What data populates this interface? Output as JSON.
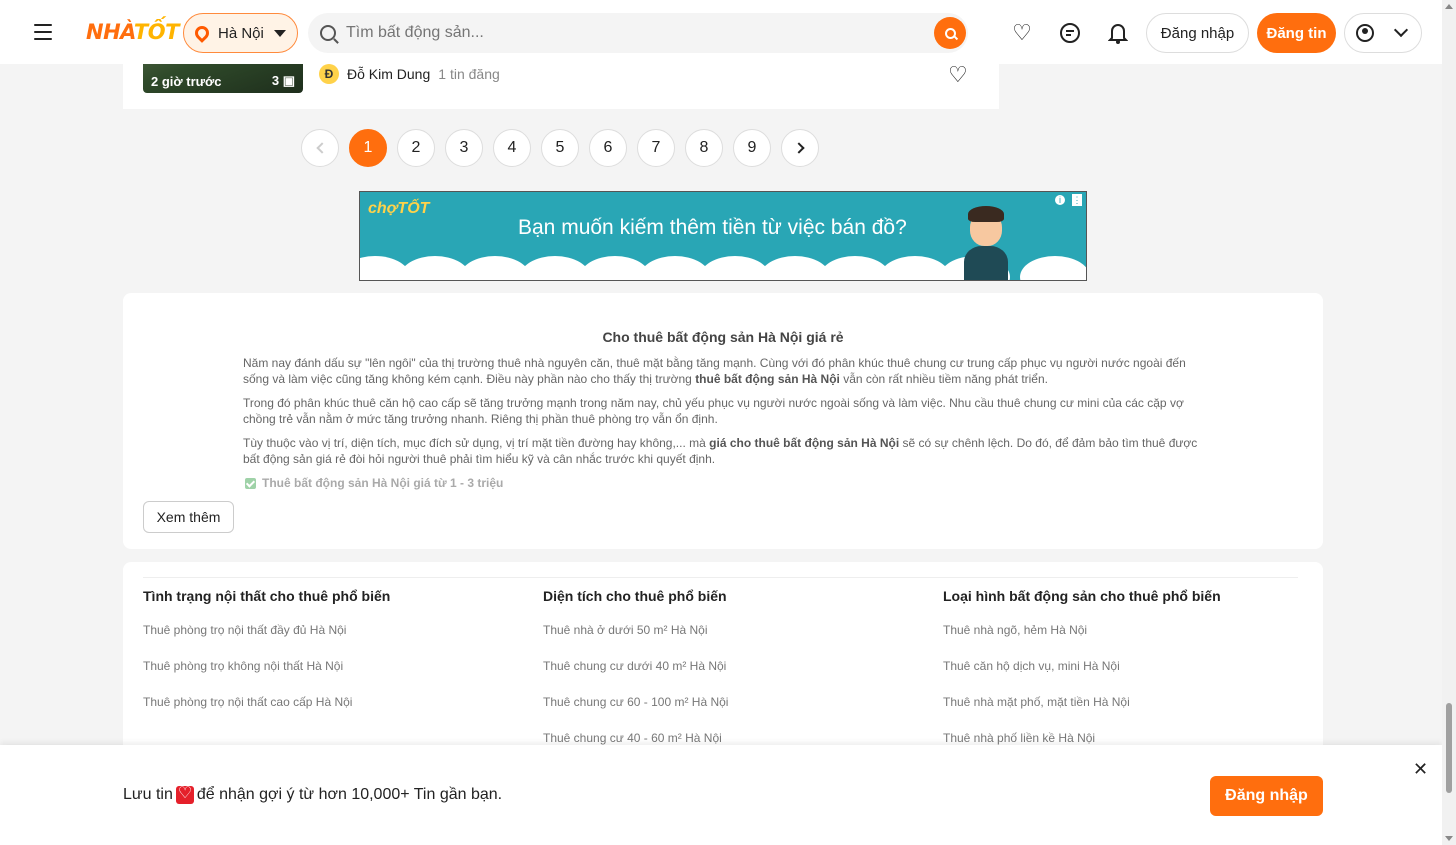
{
  "header": {
    "logo_part1": "NHÀ",
    "logo_part2": "TỐT",
    "location": "Hà Nội",
    "search_placeholder": "Tìm bất động sản...",
    "login_label": "Đăng nhập",
    "post_label": "Đăng tin"
  },
  "listing": {
    "time_ago": "2 giờ trước",
    "photo_count": "3",
    "seller_initial": "Đ",
    "seller_name": "Đỗ Kim Dung",
    "seller_posts": "1 tin đăng"
  },
  "pagination": {
    "pages": [
      "1",
      "2",
      "3",
      "4",
      "5",
      "6",
      "7",
      "8",
      "9"
    ],
    "active": "1"
  },
  "ad": {
    "brand": "chợTỐT",
    "message": "Bạn muốn kiếm thêm tiền từ việc bán đồ?"
  },
  "seo": {
    "title": "Cho thuê bất động sản Hà Nội giá rẻ",
    "p1_a": "Năm nay đánh dấu sự \"lên ngôi\" của thị trường thuê nhà nguyên căn, thuê mặt bằng tăng mạnh. Cùng với đó phân khúc thuê chung cư trung cấp phục vụ người nước ngoài đến sống và làm việc cũng tăng không kém cạnh. Điều này phần nào cho thấy thị trường ",
    "p1_b": "thuê bất động sản Hà Nội",
    "p1_c": " vẫn còn rất nhiều tiềm năng phát triển.",
    "p2": "Trong đó phân khúc thuê căn hộ cao cấp sẽ tăng trưởng mạnh trong năm nay, chủ yếu phục vụ người nước ngoài sống và làm việc. Nhu cầu thuê chung cư mini của các cặp vợ chồng trẻ vẫn nằm ở mức tăng trưởng nhanh. Riêng thị phần thuê phòng trọ vẫn ổn định.",
    "p3_a": "Tùy thuộc vào vị trí, diện tích, mục đích sử dụng, vị trí mặt tiền đường hay không,... mà ",
    "p3_b": "giá cho thuê bất động sản Hà Nội",
    "p3_c": " sẽ có sự chênh lệch. Do đó, để đảm bảo tìm thuê được bất động sản giá rẻ đòi hỏi người thuê phải tìm hiểu kỹ và cân nhắc trước khi quyết định.",
    "check_item": "Thuê bất động sản Hà Nội giá từ 1 - 3 triệu",
    "more_label": "Xem thêm"
  },
  "links": {
    "col1": {
      "title": "Tình trạng nội thất cho thuê phổ biến",
      "items": [
        "Thuê phòng trọ nội thất đầy đủ Hà Nội",
        "Thuê phòng trọ không nội thất Hà Nội",
        "Thuê phòng trọ nội thất cao cấp Hà Nội"
      ]
    },
    "col2": {
      "title": "Diện tích cho thuê phổ biến",
      "items": [
        "Thuê nhà ở dưới 50 m² Hà Nội",
        "Thuê chung cư dưới 40 m² Hà Nội",
        "Thuê chung cư 60 - 100 m² Hà Nội",
        "Thuê chung cư 40 - 60 m² Hà Nội"
      ]
    },
    "col3": {
      "title": "Loại hình bất động sản cho thuê phổ biến",
      "items": [
        "Thuê nhà ngõ, hẻm Hà Nội",
        "Thuê căn hộ dịch vụ, mini Hà Nội",
        "Thuê nhà mặt phố, mặt tiền Hà Nội",
        "Thuê nhà phố liền kề Hà Nội"
      ]
    }
  },
  "bottom_bar": {
    "text_before": "Lưu tin",
    "text_after": "để nhận gợi ý từ hơn 10,000+ Tin gần bạn.",
    "cta_label": "Đăng nhập",
    "close_glyph": "✕"
  },
  "colors": {
    "accent": "#ff6e0e",
    "ad_bg": "#29a6b5"
  }
}
